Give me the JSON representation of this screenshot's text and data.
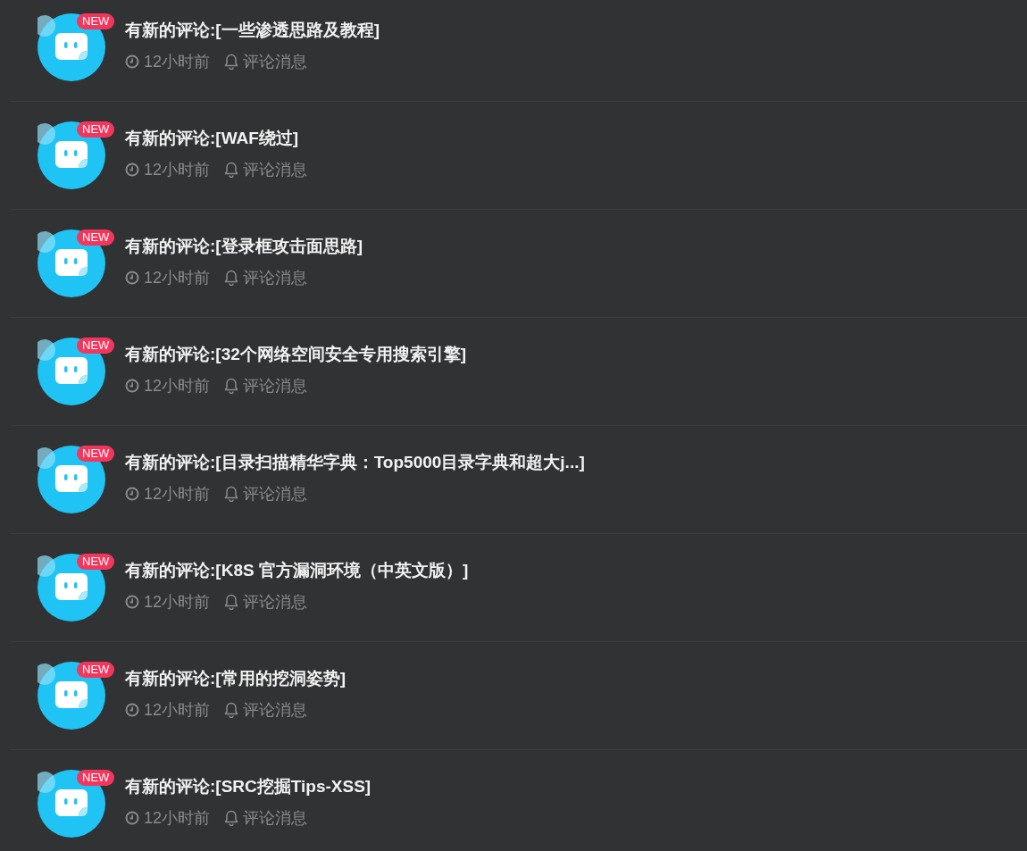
{
  "notifications": [
    {
      "badge": "NEW",
      "title": "有新的评论:[一些渗透思路及教程]",
      "time": "12小时前",
      "type": "评论消息"
    },
    {
      "badge": "NEW",
      "title": "有新的评论:[WAF绕过]",
      "time": "12小时前",
      "type": "评论消息"
    },
    {
      "badge": "NEW",
      "title": "有新的评论:[登录框攻击面思路]",
      "time": "12小时前",
      "type": "评论消息"
    },
    {
      "badge": "NEW",
      "title": "有新的评论:[32个网络空间安全专用搜索引擎]",
      "time": "12小时前",
      "type": "评论消息"
    },
    {
      "badge": "NEW",
      "title": "有新的评论:[目录扫描精华字典：Top5000目录字典和超大j...]",
      "time": "12小时前",
      "type": "评论消息"
    },
    {
      "badge": "NEW",
      "title": "有新的评论:[K8S 官方漏洞环境（中英文版）]",
      "time": "12小时前",
      "type": "评论消息"
    },
    {
      "badge": "NEW",
      "title": "有新的评论:[常用的挖洞姿势]",
      "time": "12小时前",
      "type": "评论消息"
    },
    {
      "badge": "NEW",
      "title": "有新的评论:[SRC挖掘Tips-XSS]",
      "time": "12小时前",
      "type": "评论消息"
    }
  ]
}
